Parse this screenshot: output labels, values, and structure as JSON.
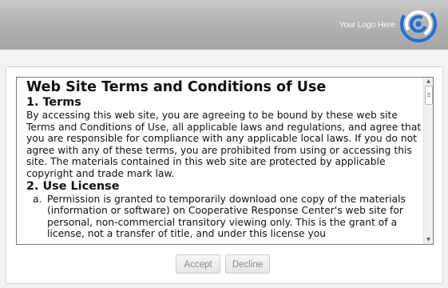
{
  "header": {
    "logo_text": "Your Logo Here",
    "logo_icon": "swirl-logo-icon",
    "logo_color": "#1e6fd9"
  },
  "terms": {
    "title": "Web Site Terms and Conditions of Use",
    "sections": [
      {
        "heading": "1. Terms",
        "body": "By accessing this web site, you are agreeing to be bound by these web site Terms and Conditions of Use, all applicable laws and regulations, and agree that you are responsible for compliance with any applicable local laws. If you do not agree with any of these terms, you are prohibited from using or accessing this site. The materials contained in this web site are protected by applicable copyright and trade mark law."
      },
      {
        "heading": "2. Use License",
        "items": [
          {
            "marker": "a.",
            "text": "Permission is granted to temporarily download one copy of the materials (information or software) on Cooperative Response Center's web site for personal, non-commercial transitory viewing only. This is the grant of a license, not a transfer of title, and under this license you"
          }
        ]
      }
    ]
  },
  "buttons": {
    "accept": "Accept",
    "decline": "Decline"
  },
  "scrollbar": {
    "up_icon": "scroll-up-arrow-icon",
    "down_icon": "scroll-down-arrow-icon"
  }
}
